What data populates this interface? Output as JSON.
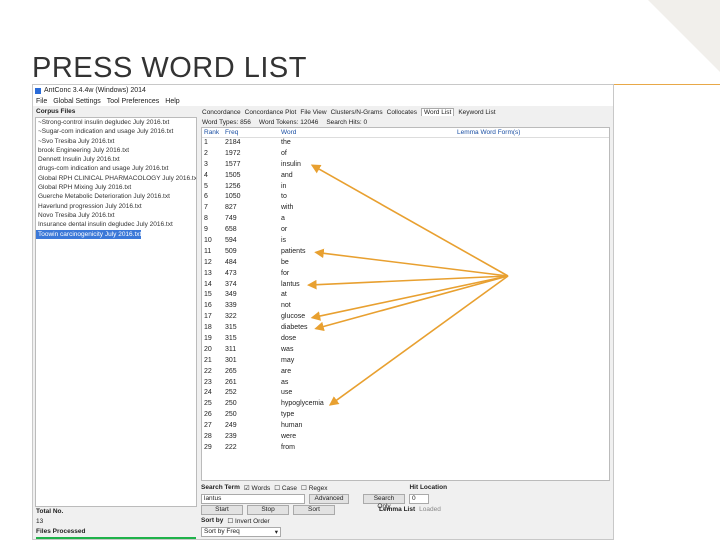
{
  "slide": {
    "title": "PRESS WORD LIST"
  },
  "app": {
    "title": "AntConc 3.4.4w (Windows) 2014",
    "menu": [
      "File",
      "Global Settings",
      "Tool Preferences",
      "Help"
    ],
    "corpus_label": "Corpus Files",
    "corpus_files": [
      "~Strong-control insulin degludec July 2016.txt",
      "~Sugar-com indication and usage July 2016.txt",
      "~Svo Tresiba July 2016.txt",
      "brook Engineering July 2016.txt",
      "Dennett Insulin July 2016.txt",
      "drugs-com indication and usage July 2016.txt",
      "Global RPH CLINICAL PHARMACOLOGY July 2016.txt",
      "Global RPH Mixing July 2016.txt",
      "Guerche Metabolic Deterioration July 2016.txt",
      "Haverlund progression July 2016.txt",
      "Novo Tresiba July 2016.txt",
      "Insurance dental insulin degludec July 2016.txt",
      "Toowin carcinogenicity July 2016.txt"
    ],
    "total_label": "Total No.",
    "total_value": "13",
    "files_processed_label": "Files Processed",
    "progress": 1.0,
    "tabs": [
      "Concordance",
      "Concordance Plot",
      "File View",
      "Clusters/N-Grams",
      "Collocates",
      "Word List",
      "Keyword List"
    ],
    "active_tab": "Word List",
    "stats": {
      "types_label": "Word Types:",
      "types_value": "856",
      "tokens_label": "Word Tokens:",
      "tokens_value": "12046",
      "search_label": "Search Hits:",
      "search_value": "0"
    },
    "columns": {
      "rank": "Rank",
      "freq": "Freq",
      "word": "Word",
      "lemma": "Lemma Word Form(s)"
    },
    "rows": [
      {
        "rank": "1",
        "freq": "2184",
        "word": "the"
      },
      {
        "rank": "2",
        "freq": "1972",
        "word": "of"
      },
      {
        "rank": "3",
        "freq": "1577",
        "word": "insulin"
      },
      {
        "rank": "4",
        "freq": "1505",
        "word": "and"
      },
      {
        "rank": "5",
        "freq": "1256",
        "word": "in"
      },
      {
        "rank": "6",
        "freq": "1050",
        "word": "to"
      },
      {
        "rank": "7",
        "freq": "827",
        "word": "with"
      },
      {
        "rank": "8",
        "freq": "749",
        "word": "a"
      },
      {
        "rank": "9",
        "freq": "658",
        "word": "or"
      },
      {
        "rank": "10",
        "freq": "594",
        "word": "is"
      },
      {
        "rank": "11",
        "freq": "509",
        "word": "patients"
      },
      {
        "rank": "12",
        "freq": "484",
        "word": "be"
      },
      {
        "rank": "13",
        "freq": "473",
        "word": "for"
      },
      {
        "rank": "14",
        "freq": "374",
        "word": "lantus"
      },
      {
        "rank": "15",
        "freq": "349",
        "word": "at"
      },
      {
        "rank": "16",
        "freq": "339",
        "word": "not"
      },
      {
        "rank": "17",
        "freq": "322",
        "word": "glucose"
      },
      {
        "rank": "18",
        "freq": "315",
        "word": "diabetes"
      },
      {
        "rank": "19",
        "freq": "315",
        "word": "dose"
      },
      {
        "rank": "20",
        "freq": "311",
        "word": "was"
      },
      {
        "rank": "21",
        "freq": "301",
        "word": "may"
      },
      {
        "rank": "22",
        "freq": "265",
        "word": "are"
      },
      {
        "rank": "23",
        "freq": "261",
        "word": "as"
      },
      {
        "rank": "24",
        "freq": "252",
        "word": "use"
      },
      {
        "rank": "25",
        "freq": "250",
        "word": "hypoglycemia"
      },
      {
        "rank": "26",
        "freq": "250",
        "word": "type"
      },
      {
        "rank": "27",
        "freq": "249",
        "word": "human"
      },
      {
        "rank": "28",
        "freq": "239",
        "word": "were"
      },
      {
        "rank": "29",
        "freq": "222",
        "word": "from"
      }
    ],
    "search_term_label": "Search Term",
    "opt_words": "Words",
    "opt_case": "Case",
    "opt_regex": "Regex",
    "search_value": "lantus",
    "advanced_label": "Advanced",
    "hit_location_label": "Hit Location",
    "search_only_label": "Search Only",
    "hit_value": "0",
    "start_label": "Start",
    "stop_label": "Stop",
    "sort_btn_label": "Sort",
    "lemma_list_label": "Lemma List",
    "loaded_label": "Loaded",
    "sort_by_label": "Sort by",
    "invert_label": "Invert Order",
    "sort_select_value": "Sort by Freq"
  },
  "colors": {
    "arrow": "#e8a030",
    "accent": "#e8a848",
    "selection": "#3b78d8",
    "progress": "#1fb24a"
  }
}
